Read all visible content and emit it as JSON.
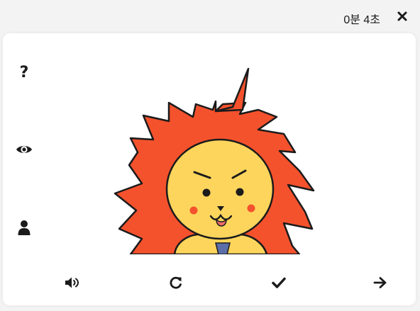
{
  "header": {
    "timer_text": "0분 4초"
  },
  "sidebar": {
    "buttons": [
      {
        "icon": "question-icon"
      },
      {
        "icon": "eye-icon"
      },
      {
        "icon": "user-icon"
      }
    ]
  },
  "illustration": {
    "subject": "lion-character",
    "mane_color": "#f4522d",
    "face_color": "#fdd55c",
    "cheek_color": "#f4522d",
    "tongue_color": "#ef6b6b",
    "tie_color": "#5b6ea8"
  },
  "toolbar": {
    "buttons": [
      {
        "icon": "volume-icon"
      },
      {
        "icon": "redo-icon"
      },
      {
        "icon": "check-icon"
      },
      {
        "icon": "arrow-right-icon"
      }
    ]
  },
  "colors": {
    "background": "#f3f3f3",
    "card": "#ffffff",
    "icon": "#1b1b1b"
  }
}
